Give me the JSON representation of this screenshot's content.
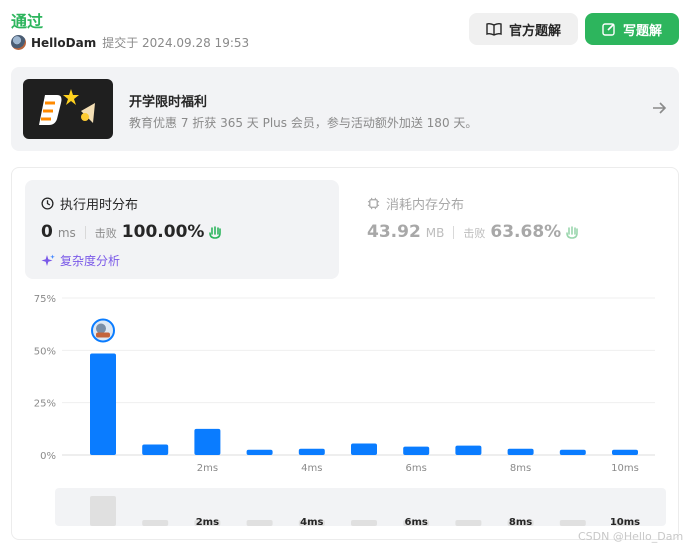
{
  "header": {
    "status": "通过",
    "username": "HelloDam",
    "submitted_text": "提交于 2024.09.28 19:53",
    "official_solution_label": "官方题解",
    "write_solution_label": "写题解"
  },
  "banner": {
    "title": "开学限时福利",
    "subtitle": "教育优惠 7 折获 365 天 Plus 会员，参与活动额外加送 180 天。"
  },
  "runtime": {
    "title": "执行用时分布",
    "value": "0",
    "unit": "ms",
    "beat_label": "击败",
    "beat_pct": "100.00%",
    "complexity_label": "复杂度分析"
  },
  "memory": {
    "title": "消耗内存分布",
    "value": "43.92",
    "unit": "MB",
    "beat_label": "击败",
    "beat_pct": "63.68%"
  },
  "colors": {
    "accent_green": "#2db55d",
    "bar_blue": "#0a7cff",
    "purple": "#7a59e8",
    "hand_green": "#2db55d"
  },
  "chart_data": {
    "type": "bar",
    "x": [
      0,
      1,
      2,
      3,
      4,
      5,
      6,
      7,
      8,
      9,
      10
    ],
    "x_unit": "ms",
    "values": [
      48.5,
      5,
      12.5,
      2.5,
      3,
      5.5,
      4,
      4.5,
      3,
      2.5,
      2.5
    ],
    "y_ticks": [
      "0%",
      "25%",
      "50%",
      "75%"
    ],
    "x_tick_labels": [
      "2ms",
      "4ms",
      "6ms",
      "8ms",
      "10ms"
    ],
    "ylim": [
      0,
      75
    ],
    "highlight_index": 0,
    "overview_values": [
      15,
      3,
      3,
      3,
      3,
      3,
      3,
      3,
      3,
      3,
      3
    ],
    "grid": true
  },
  "watermark": "CSDN @Hello_Dam"
}
